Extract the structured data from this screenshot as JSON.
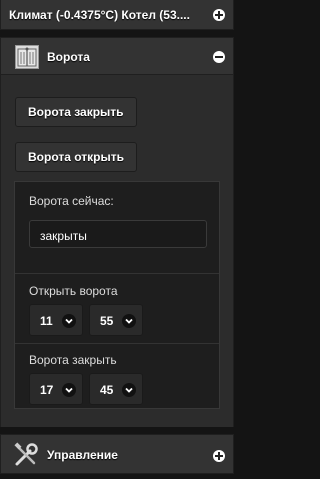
{
  "header_climate": {
    "title": "Климат (-0.4375°C) Котел (53...."
  },
  "gate_section": {
    "title": "Ворота",
    "close_button": "Ворота закрыть",
    "open_button": "Ворота открыть",
    "status_label": "Ворота сейчас:",
    "status_value": "закрыты",
    "open_time": {
      "label": "Открыть ворота",
      "hour": "11",
      "minute": "55"
    },
    "close_time": {
      "label": "Ворота закрыть",
      "hour": "17",
      "minute": "45"
    }
  },
  "header_control": {
    "title": "Управление"
  }
}
